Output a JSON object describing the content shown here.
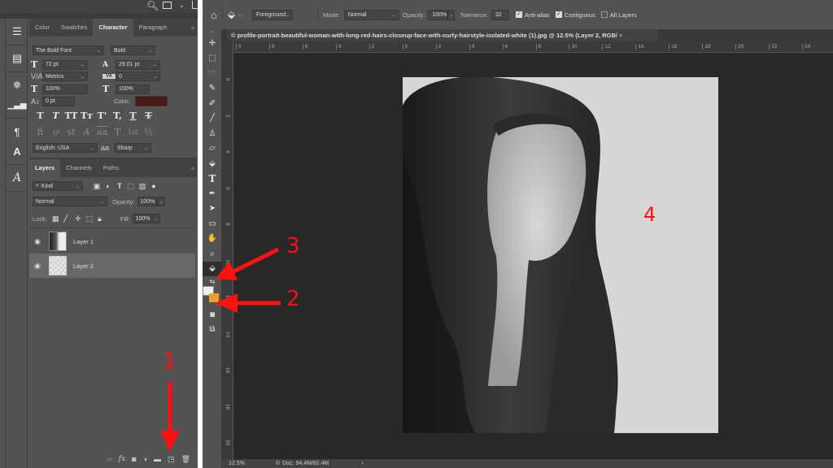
{
  "left_panel": {
    "topbar_icons": [
      "search-icon",
      "workspace-icon",
      "chevron-down-icon",
      "share-icon"
    ],
    "icon_column": [
      "history-icon",
      "properties-icon",
      "adjustments-icon",
      "levels-icon",
      "paragraph-styles-icon",
      "character-styles-icon",
      "glyphs-icon"
    ],
    "character_panel": {
      "tabs": [
        "Color",
        "Swatches",
        "Character",
        "Paragraph"
      ],
      "active_tab": "Character",
      "font_family": "The Bold Font",
      "font_style": "Bold",
      "font_size": "72 pt",
      "leading": "29.01 pt",
      "kerning": "Metrics",
      "tracking": "0",
      "vertical_scale": "100%",
      "horizontal_scale": "100%",
      "baseline_shift": "0 pt",
      "color_label": "Color:",
      "color_value": "#4a1a14",
      "type_buttons": [
        "T",
        "T",
        "TT",
        "Tт",
        "T'",
        "T,",
        "T",
        "T"
      ],
      "opentype_buttons": [
        "fi",
        "ơ",
        "st",
        "A",
        "aa",
        "T",
        "1st",
        "½"
      ],
      "language": "English: USA",
      "antialias_label": "aa",
      "antialias": "Sharp"
    },
    "layers_panel": {
      "tabs": [
        "Layers",
        "Channels",
        "Paths"
      ],
      "active_tab": "Layers",
      "filter_kind": "Kind",
      "blend_mode": "Normal",
      "opacity_label": "Opacity:",
      "opacity": "100%",
      "lock_label": "Lock:",
      "fill_label": "Fill:",
      "fill": "100%",
      "layers": [
        {
          "name": "Layer 1",
          "visible": true,
          "selected": false
        },
        {
          "name": "Layer 2",
          "visible": true,
          "selected": true
        }
      ],
      "footer_icons": [
        "link-layers-icon",
        "fx-icon",
        "add-mask-icon",
        "adjustment-layer-icon",
        "new-group-icon",
        "new-layer-icon",
        "delete-layer-icon"
      ]
    }
  },
  "options_bar": {
    "fill_source": "Foreground",
    "mode_label": "Mode:",
    "mode": "Normal",
    "opacity_label": "Opacity:",
    "opacity": "100%",
    "tolerance_label": "Tolerance:",
    "tolerance": "32",
    "anti_alias_label": "Anti-alias",
    "anti_alias": true,
    "contiguous_label": "Contiguous",
    "contiguous": true,
    "all_layers_label": "All Layers",
    "all_layers": false
  },
  "document": {
    "tab_title": "© profile-portrait-beautiful-woman-with-long-red-hairs-closeup-face-with-curly-hairstyle-isolated-white (1).jpg @ 12.5% (Layer 2, RGB/",
    "h_ruler_ticks": [
      "3",
      "8",
      "6",
      "4",
      "2",
      "0",
      "2",
      "4",
      "6",
      "8",
      "10",
      "12",
      "14",
      "16",
      "18",
      "20",
      "22",
      "24"
    ],
    "v_ruler_ticks": [
      "0",
      "2",
      "4",
      "6",
      "8",
      "10",
      "12",
      "14",
      "16",
      "18",
      "20"
    ]
  },
  "status_bar": {
    "zoom": "12.5%",
    "doc_info": "Doc: 94.4M/82.4M"
  },
  "annotations": [
    {
      "number": "1",
      "target": "new-layer-button"
    },
    {
      "number": "2",
      "target": "foreground-background-colors"
    },
    {
      "number": "3",
      "target": "paint-bucket-tool"
    },
    {
      "number": "4",
      "target": "canvas-background"
    }
  ],
  "colors": {
    "annotation_red": "#ff1111",
    "foreground_color": "#f0f0f0",
    "background_color": "#e8a030"
  }
}
